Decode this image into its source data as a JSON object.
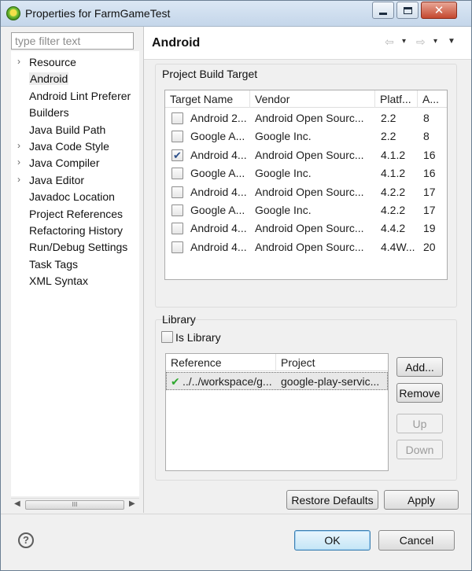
{
  "window": {
    "title": "Properties for FarmGameTest"
  },
  "sidebar": {
    "filter_placeholder": "type filter text",
    "items": [
      {
        "label": "Resource",
        "expander": "›"
      },
      {
        "label": "Android",
        "expander": ""
      },
      {
        "label": "Android Lint Preferer",
        "expander": ""
      },
      {
        "label": "Builders",
        "expander": ""
      },
      {
        "label": "Java Build Path",
        "expander": ""
      },
      {
        "label": "Java Code Style",
        "expander": "›"
      },
      {
        "label": "Java Compiler",
        "expander": "›"
      },
      {
        "label": "Java Editor",
        "expander": "›"
      },
      {
        "label": "Javadoc Location",
        "expander": ""
      },
      {
        "label": "Project References",
        "expander": ""
      },
      {
        "label": "Refactoring History",
        "expander": ""
      },
      {
        "label": "Run/Debug Settings",
        "expander": ""
      },
      {
        "label": "Task Tags",
        "expander": ""
      },
      {
        "label": "XML Syntax",
        "expander": ""
      }
    ],
    "selected": "Android",
    "scroll_thumb_grip": "III"
  },
  "page": {
    "title": "Android"
  },
  "build_target": {
    "group_label": "Project Build Target",
    "columns": [
      "Target Name",
      "Vendor",
      "Platf...",
      "A..."
    ],
    "rows": [
      {
        "name": "Android 2...",
        "vendor": "Android Open Sourc...",
        "platform": "2.2",
        "api": "8",
        "checked": false
      },
      {
        "name": "Google A...",
        "vendor": "Google Inc.",
        "platform": "2.2",
        "api": "8",
        "checked": false
      },
      {
        "name": "Android 4...",
        "vendor": "Android Open Sourc...",
        "platform": "4.1.2",
        "api": "16",
        "checked": true
      },
      {
        "name": "Google A...",
        "vendor": "Google Inc.",
        "platform": "4.1.2",
        "api": "16",
        "checked": false
      },
      {
        "name": "Android 4...",
        "vendor": "Android Open Sourc...",
        "platform": "4.2.2",
        "api": "17",
        "checked": false
      },
      {
        "name": "Google A...",
        "vendor": "Google Inc.",
        "platform": "4.2.2",
        "api": "17",
        "checked": false
      },
      {
        "name": "Android 4...",
        "vendor": "Android Open Sourc...",
        "platform": "4.4.2",
        "api": "19",
        "checked": false
      },
      {
        "name": "Android 4...",
        "vendor": "Android Open Sourc...",
        "platform": "4.4W...",
        "api": "20",
        "checked": false
      }
    ]
  },
  "library": {
    "group_label": "Library",
    "is_library_label": "Is Library",
    "is_library_checked": false,
    "columns": [
      "Reference",
      "Project"
    ],
    "rows": [
      {
        "reference": "../../workspace/g...",
        "project": "google-play-servic...",
        "ok_icon": "✔"
      }
    ],
    "buttons": {
      "add": "Add...",
      "remove": "Remove",
      "up": "Up",
      "down": "Down"
    }
  },
  "actions": {
    "restore_defaults": "Restore Defaults",
    "apply": "Apply",
    "ok": "OK",
    "cancel": "Cancel"
  },
  "icons": {
    "help": "?",
    "back": "⇦",
    "forward": "⇨",
    "dropdown": "▾",
    "menu": "▼"
  },
  "colors": {
    "check_green": "#2ea82e",
    "default_button_border": "#3c7fb1"
  }
}
